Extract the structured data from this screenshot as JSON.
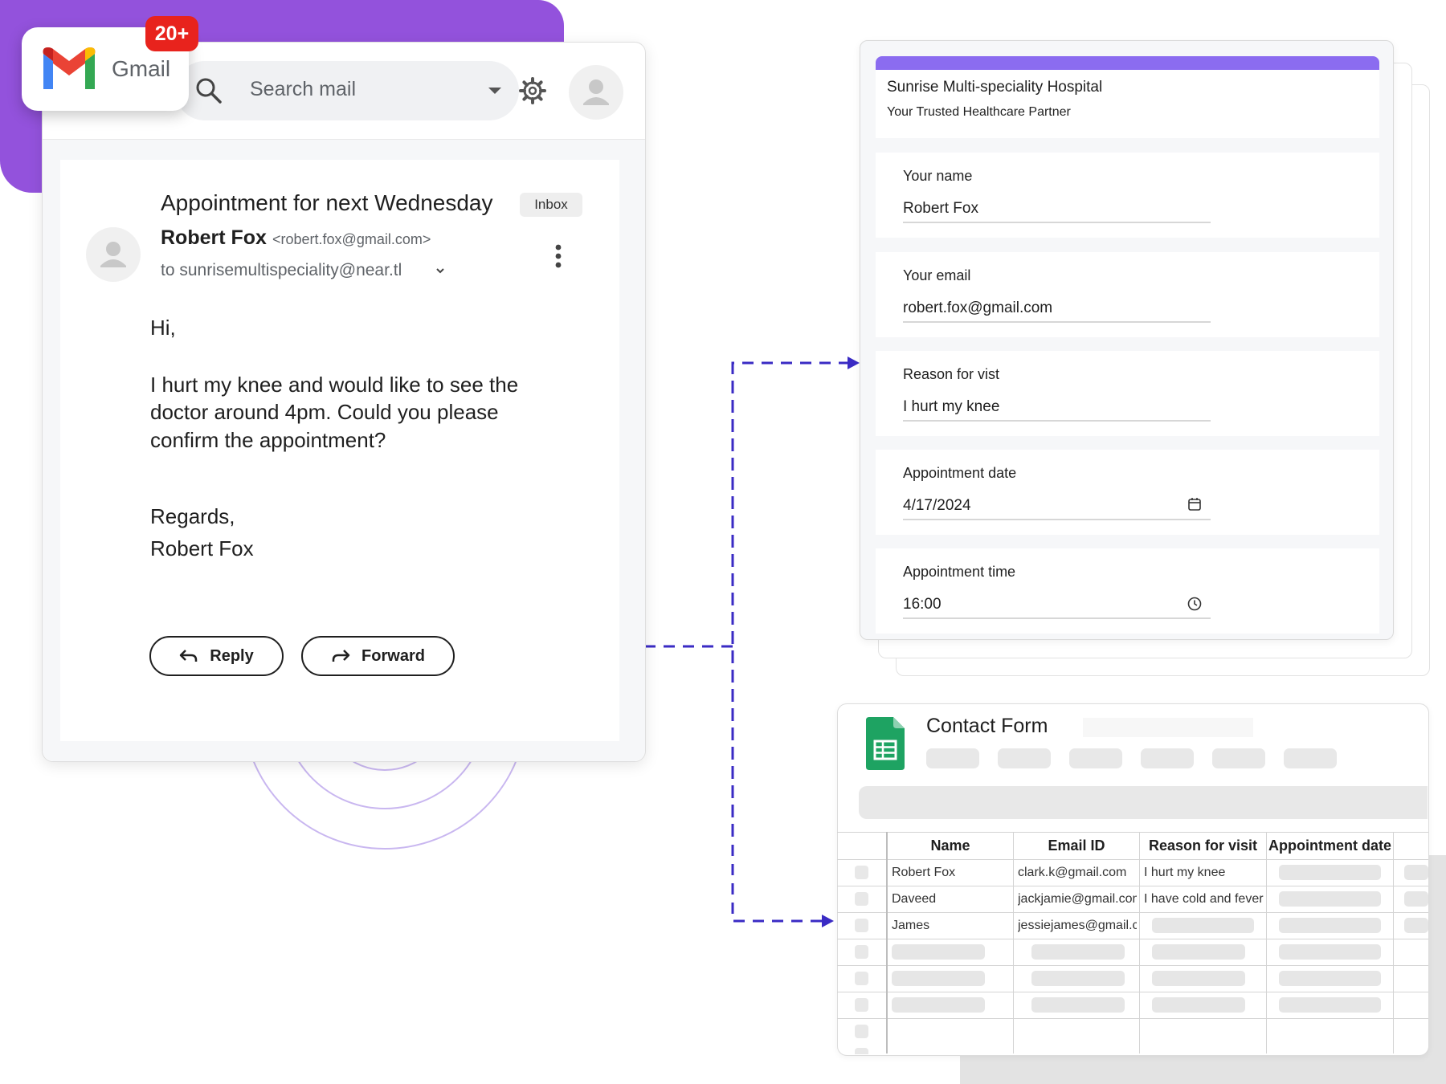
{
  "gmail": {
    "app_name": "Gmail",
    "notification_count": "20+",
    "search_placeholder": "Search mail",
    "email": {
      "subject": "Appointment for next Wednesday",
      "label": "Inbox",
      "sender_name": "Robert Fox",
      "sender_email": "<robert.fox@gmail.com>",
      "to": "to sunrisemultispeciality@near.tl",
      "greeting": "Hi,",
      "body_lines": [
        "I hurt my knee and would like to see the",
        "doctor around 4pm. Could you please",
        "confirm the appointment?"
      ],
      "signoff": "Regards,",
      "signature": "Robert Fox"
    },
    "reply_label": "Reply",
    "forward_label": "Forward"
  },
  "form": {
    "title": "Sunrise Multi-speciality Hospital",
    "subtitle": "Your Trusted Healthcare Partner",
    "accent_color": "#8b6cf0",
    "fields": [
      {
        "label": "Your name",
        "value": "Robert Fox"
      },
      {
        "label": "Your email",
        "value": "robert.fox@gmail.com"
      },
      {
        "label": "Reason for vist",
        "value": "I hurt my knee"
      },
      {
        "label": "Appointment date",
        "value": "4/17/2024",
        "icon": "calendar-icon"
      },
      {
        "label": "Appointment time",
        "value": "16:00",
        "icon": "clock-icon"
      }
    ]
  },
  "sheet": {
    "title": "Contact Form",
    "columns": [
      "Name",
      "Email ID",
      "Reason for visit",
      "Appointment date"
    ],
    "rows": [
      [
        "Robert Fox",
        "clark.k@gmail.com",
        "I hurt my knee",
        ""
      ],
      [
        "Daveed",
        "jackjamie@gmail.com",
        "I  have cold and fever",
        ""
      ],
      [
        "James",
        "jessiejames@gmail.com",
        "",
        ""
      ]
    ]
  },
  "colors": {
    "brand_purple": "#9352dc",
    "connector": "#3a2bc4",
    "badge_red": "#e8231d",
    "sheets_green": "#1ea362"
  }
}
